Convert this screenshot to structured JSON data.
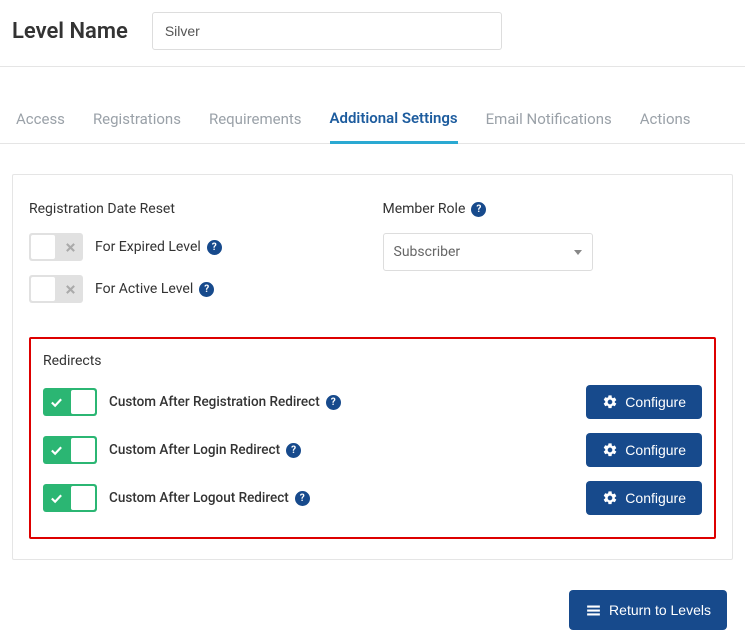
{
  "header": {
    "label": "Level Name",
    "value": "Silver"
  },
  "tabs": [
    {
      "label": "Access",
      "active": false
    },
    {
      "label": "Registrations",
      "active": false
    },
    {
      "label": "Requirements",
      "active": false
    },
    {
      "label": "Additional Settings",
      "active": true
    },
    {
      "label": "Email Notifications",
      "active": false
    },
    {
      "label": "Actions",
      "active": false
    }
  ],
  "reg_reset": {
    "title": "Registration Date Reset",
    "items": [
      {
        "label": "For Expired Level",
        "on": false
      },
      {
        "label": "For Active Level",
        "on": false
      }
    ]
  },
  "member_role": {
    "title": "Member Role",
    "selected": "Subscriber"
  },
  "redirects": {
    "title": "Redirects",
    "configure_label": "Configure",
    "items": [
      {
        "label": "Custom After Registration Redirect",
        "on": true
      },
      {
        "label": "Custom After Login Redirect",
        "on": true
      },
      {
        "label": "Custom After Logout Redirect",
        "on": true
      }
    ]
  },
  "footer": {
    "return_label": "Return to Levels"
  }
}
